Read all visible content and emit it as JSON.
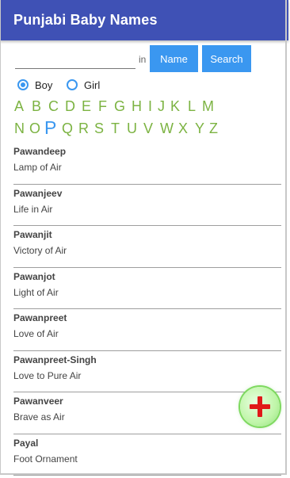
{
  "appbar": {
    "title": "Punjabi Baby Names"
  },
  "search": {
    "placeholder": "",
    "value": "",
    "in_label": "in",
    "name_button": "Name",
    "search_button": "Search"
  },
  "gender": {
    "boy_label": "Boy",
    "girl_label": "Girl",
    "selected": "Boy"
  },
  "letters": {
    "row1": [
      "A",
      "B",
      "C",
      "D",
      "E",
      "F",
      "G",
      "H",
      "I",
      "J",
      "K",
      "L",
      "M"
    ],
    "row2": [
      "N",
      "O",
      "P",
      "Q",
      "R",
      "S",
      "T",
      "U",
      "V",
      "W",
      "X",
      "Y",
      "Z"
    ],
    "selected": "P"
  },
  "names": [
    {
      "name": "Pawandeep",
      "meaning": "Lamp of Air"
    },
    {
      "name": "Pawanjeev",
      "meaning": "Life in Air"
    },
    {
      "name": "Pawanjit",
      "meaning": "Victory of Air"
    },
    {
      "name": "Pawanjot",
      "meaning": "Light of Air"
    },
    {
      "name": "Pawanpreet",
      "meaning": "Love of Air"
    },
    {
      "name": "Pawanpreet-Singh",
      "meaning": "Love to Pure Air"
    },
    {
      "name": "Pawanveer",
      "meaning": "Brave as Air"
    },
    {
      "name": "Payal",
      "meaning": "Foot Ornament"
    }
  ],
  "fab": {
    "icon": "plus-icon",
    "color": "#e01818"
  },
  "colors": {
    "primary": "#3f51b5",
    "accent": "#3a97f0",
    "letter": "#7cb342"
  }
}
